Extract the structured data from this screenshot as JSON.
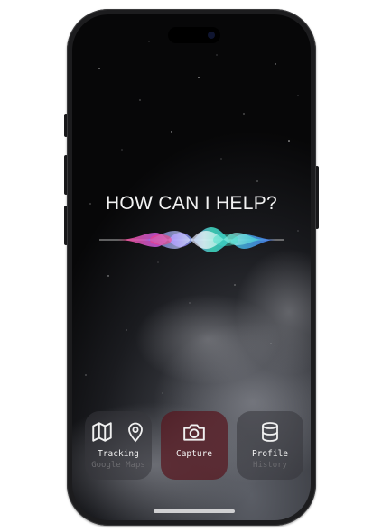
{
  "siri": {
    "prompt": "HOW CAN I HELP?"
  },
  "apps": [
    {
      "title": "Tracking",
      "subtitle": "Google Maps",
      "icons": [
        "map-icon",
        "location-pin-icon"
      ]
    },
    {
      "title": "Capture",
      "subtitle": "",
      "icons": [
        "camera-icon"
      ],
      "active": true
    },
    {
      "title": "Profile",
      "subtitle": "History",
      "icons": [
        "database-icon"
      ]
    }
  ],
  "colors": {
    "active_tile": "#58161e",
    "tile": "#37373c",
    "wave_pink": "#ff3d7f",
    "wave_teal": "#3fe0c5",
    "wave_blue": "#4a7bff"
  }
}
